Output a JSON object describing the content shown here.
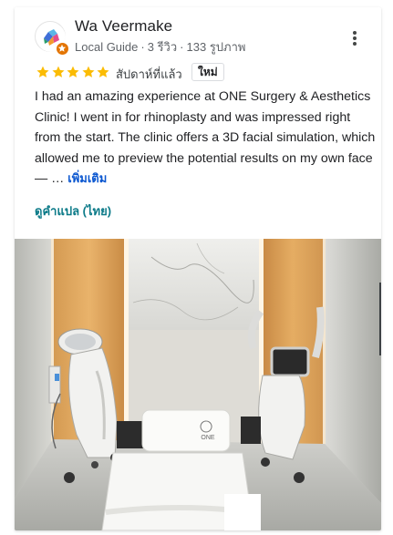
{
  "review": {
    "author": "Wa Veermake",
    "meta": {
      "role": "Local Guide",
      "reviews": "3 รีวิว",
      "photos": "133 รูปภาพ",
      "separator": "·"
    },
    "rating": 5,
    "time": "สัปดาห์ที่แล้ว",
    "new_badge": "ใหม่",
    "text": "I had an amazing experience at ONE Surgery & Aesthetics Clinic! I went in for rhinoplasty and was impressed right from the start. The clinic offers a 3D facial simulation, which allowed me to preview the potential results on my own face — …",
    "more_label": "เพิ่มเติม",
    "translate_label": "ดูคำแปล (ไทย)",
    "photo_brand": "ONE"
  },
  "colors": {
    "star": "#fbbc04",
    "link": "#0b57d0",
    "translate": "#0b7a88",
    "badge": "#e37400"
  },
  "icons": {
    "avatar": "profile-avatar-icon",
    "local_guide": "local-guide-star-icon",
    "more": "more-vert-icon",
    "star": "star-icon"
  }
}
